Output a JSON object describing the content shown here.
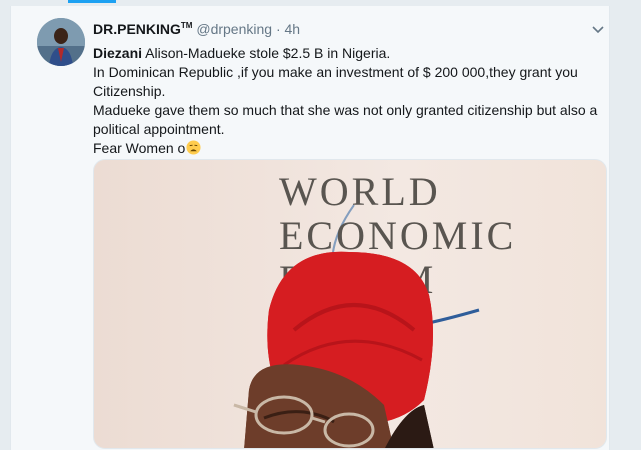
{
  "tweet": {
    "display_name": "DR.PENKING",
    "trademark": "TM",
    "handle": "@drpenking",
    "separator": "·",
    "time": "4h",
    "lines": {
      "l1_bold": "Diezani",
      "l1_rest": " Alison-Madueke stole $2.5 B in Nigeria.",
      "l2": " In Dominican Republic ,if you make an investment of $ 200 000,they grant you Citizenship.",
      "l3": "Madueke gave them so much that she was not only granted citizenship but also a political appointment.",
      "l4": "Fear Women o"
    },
    "emoji": "weary-face",
    "image": {
      "line1": "WORLD",
      "line2": "ECONOMIC",
      "line3": "FORUM"
    }
  },
  "colors": {
    "accent": "#1da1f2",
    "text": "#14171a",
    "muted": "#657786",
    "background": "#e6ecf0",
    "card": "#f5f8fa",
    "headwrap": "#d9141c"
  },
  "icons": {
    "caret": "chevron-down-icon",
    "avatar": "avatar"
  }
}
